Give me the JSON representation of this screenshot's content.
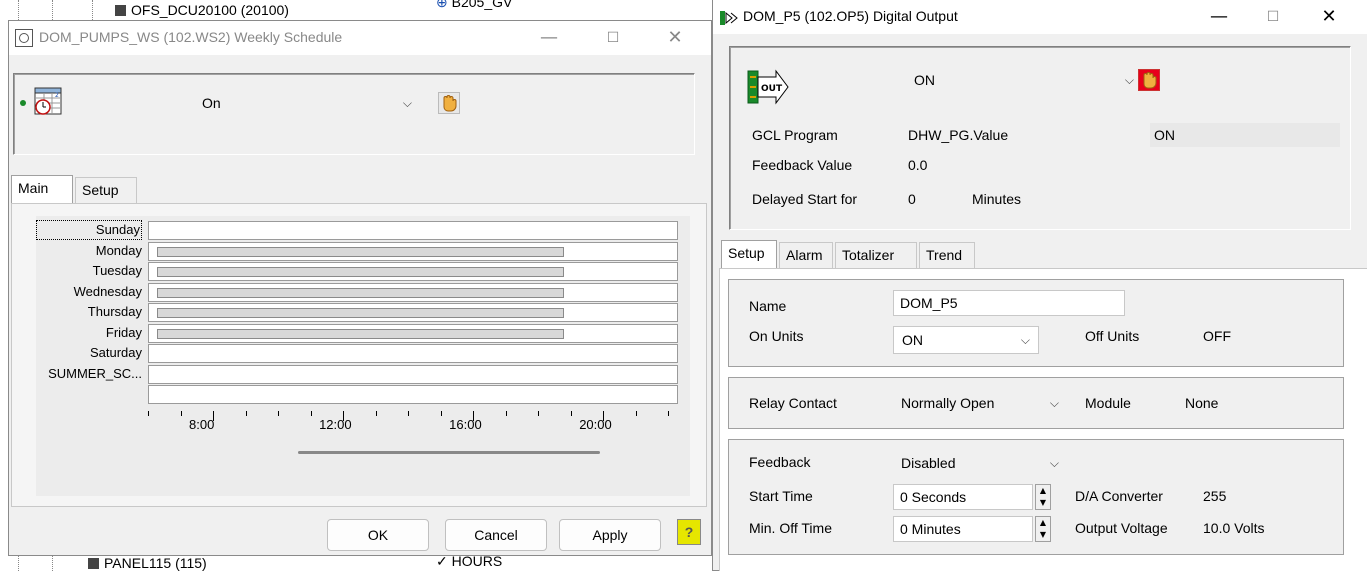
{
  "background": {
    "tree_top_item": "OFS_DCU20100 (20100)",
    "tree_top_right": "B205_GV",
    "tree_bottom_item": "PANEL115 (115)",
    "tree_bottom_right": "HOURS"
  },
  "weekly_window": {
    "title": "DOM_PUMPS_WS  (102.WS2)  Weekly Schedule",
    "icon": "calendar-clock-icon",
    "state_value": "On",
    "tabs": [
      "Main",
      "Setup"
    ],
    "days": [
      {
        "label": "Sunday",
        "on": null,
        "off": null
      },
      {
        "label": "Monday",
        "on": "06:15",
        "off": "18:45"
      },
      {
        "label": "Tuesday",
        "on": "06:15",
        "off": "18:45"
      },
      {
        "label": "Wednesday",
        "on": "06:15",
        "off": "18:45"
      },
      {
        "label": "Thursday",
        "on": "06:15",
        "off": "18:45"
      },
      {
        "label": "Friday",
        "on": "06:15",
        "off": "18:45"
      },
      {
        "label": "Saturday",
        "on": null,
        "off": null
      },
      {
        "label": "SUMMER_SC...",
        "on": null,
        "off": null
      },
      {
        "label": "",
        "on": null,
        "off": null
      }
    ],
    "timeline_labels": [
      "8:00",
      "12:00",
      "16:00",
      "20:00"
    ],
    "buttons": {
      "ok": "OK",
      "cancel": "Cancel",
      "apply": "Apply"
    }
  },
  "digital_window": {
    "title": "DOM_P5  (102.OP5)  Digital Output",
    "icon": "digital-output-icon",
    "state_value": "ON",
    "gcl_program_label": "GCL Program",
    "gcl_program_value": "DHW_PG.Value",
    "gcl_program_state": "ON",
    "feedback_label": "Feedback Value",
    "feedback_value": "0.0",
    "delayed_label": "Delayed Start for",
    "delayed_value": "0",
    "delayed_unit": "Minutes",
    "tabs": [
      "Setup",
      "Alarm",
      "Totalizer",
      "Trend"
    ],
    "name_label": "Name",
    "name_value": "DOM_P5",
    "on_units_label": "On Units",
    "on_units_value": "ON",
    "off_units_label": "Off Units",
    "off_units_value": "OFF",
    "relay_label": "Relay Contact",
    "relay_value": "Normally Open",
    "module_label": "Module",
    "module_value": "None",
    "feedback_sel_label": "Feedback",
    "feedback_sel_value": "Disabled",
    "start_time_label": "Start Time",
    "start_time_value": "0 Seconds",
    "min_off_label": "Min. Off Time",
    "min_off_value": "0 Minutes",
    "da_label": "D/A Converter",
    "da_value": "255",
    "voltage_label": "Output Voltage",
    "voltage_value": "10.0  Volts"
  },
  "colors": {
    "manual_hand_active": "#e8001c",
    "manual_hand_inactive": "#f0b040",
    "help_icon": "#e6e600"
  }
}
